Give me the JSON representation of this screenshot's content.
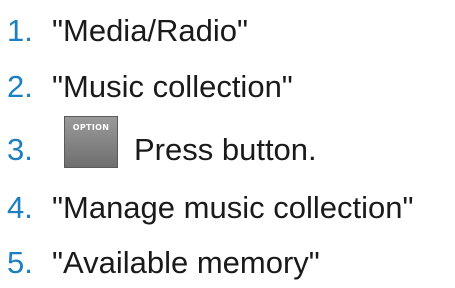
{
  "steps": [
    {
      "number": "1.",
      "text": "\"Media/Radio\""
    },
    {
      "number": "2.",
      "text": "\"Music collection\""
    },
    {
      "number": "3.",
      "button_label": "OPTION",
      "text": "Press button."
    },
    {
      "number": "4.",
      "text": "\"Manage music collection\""
    },
    {
      "number": "5.",
      "text": "\"Available memory\""
    }
  ],
  "colors": {
    "step_number": "#1d7fc1",
    "text": "#1a1a1a",
    "button_bg": "#808080"
  },
  "icons": {
    "option_button": "option-button-icon"
  }
}
